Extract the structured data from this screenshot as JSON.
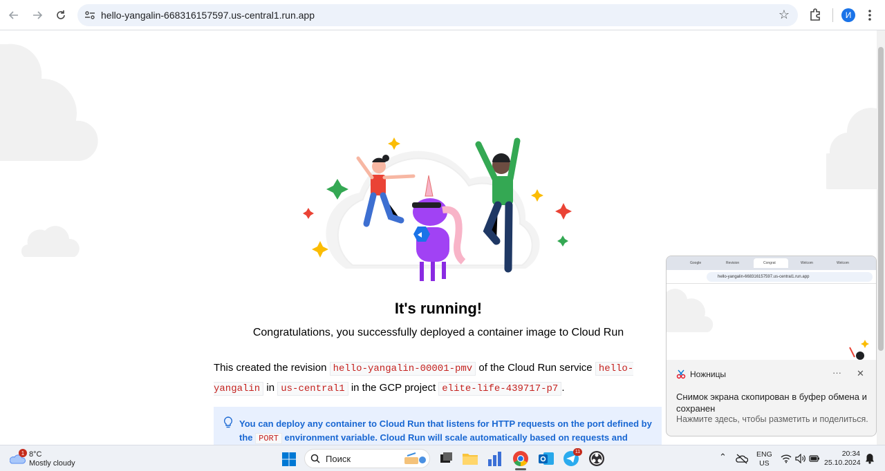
{
  "browser": {
    "url": "hello-yangalin-668316157597.us-central1.run.app",
    "profile_initial": "И"
  },
  "page": {
    "title": "It's running!",
    "subtitle": "Congratulations, you successfully deployed a container image to Cloud Run",
    "revision_text_1": "This created the revision ",
    "revision": "hello-yangalin-00001-pmv",
    "revision_text_2": " of the Cloud Run service ",
    "service": "hello-yangalin",
    "revision_text_3": " in ",
    "region": "us-central1",
    "revision_text_4": " in the GCP project ",
    "project": "elite-life-439717-p7",
    "revision_text_5": ".",
    "info_text_1": "You can deploy any container to Cloud Run that listens for HTTP requests on the port defined by the ",
    "info_code": "PORT",
    "info_text_2": " environment variable. Cloud Run will scale automatically based on requests and"
  },
  "toast": {
    "mini_tabs": [
      "Google",
      "Revision",
      "Congrat",
      "Welcom",
      "Welcom"
    ],
    "mini_url": "hello-yangalin-668316157597.us-central1.run.app",
    "app_name": "Ножницы",
    "more": "···",
    "close": "✕",
    "message": "Снимок экрана скопирован в буфер обмена и сохранен",
    "sub": "Нажмите здесь, чтобы разметить и поделиться."
  },
  "taskbar": {
    "weather_badge": "1",
    "weather_temp": "8°C",
    "weather_desc": "Mostly cloudy",
    "search_placeholder": "Поиск",
    "telegram_badge": "11",
    "lang_1": "ENG",
    "lang_2": "US",
    "time": "20:34",
    "date": "25.10.2024"
  },
  "colors": {
    "accent": "#1a73e8",
    "code_text": "#c5221f",
    "info_bg": "#e8f0fe",
    "info_text": "#1967d2"
  }
}
